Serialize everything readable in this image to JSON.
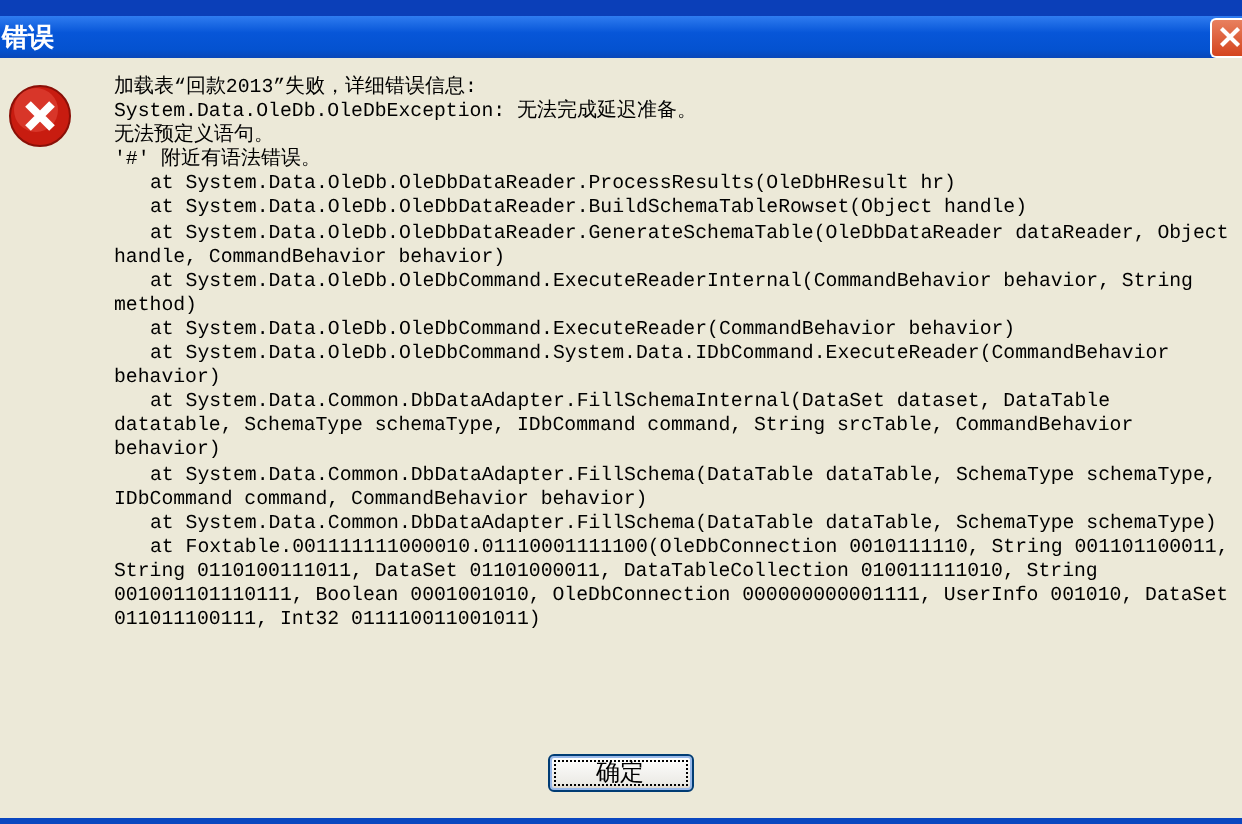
{
  "window": {
    "title": "错误"
  },
  "message": {
    "lines": [
      {
        "kind": "text",
        "text": "加载表“回款2013”失败，详细错误信息:"
      },
      {
        "kind": "text",
        "text": "System.Data.OleDb.OleDbException: 无法完成延迟准备。"
      },
      {
        "kind": "text",
        "text": "无法预定义语句。"
      },
      {
        "kind": "text",
        "text": "'#' 附近有语法错误。"
      },
      {
        "kind": "frame",
        "text": "at System.Data.OleDb.OleDbDataReader.ProcessResults(OleDbHResult hr)"
      },
      {
        "kind": "frame",
        "text": "at System.Data.OleDb.OleDbDataReader.BuildSchemaTableRowset(Object handle)"
      },
      {
        "kind": "frame",
        "text": "at System.Data.OleDb.OleDbDataReader.GenerateSchemaTable(OleDbDataReader dataReader, Object"
      },
      {
        "kind": "text",
        "text": "handle, CommandBehavior behavior)"
      },
      {
        "kind": "frame",
        "text": "at System.Data.OleDb.OleDbCommand.ExecuteReaderInternal(CommandBehavior behavior, String"
      },
      {
        "kind": "text",
        "text": "method)"
      },
      {
        "kind": "frame",
        "text": "at System.Data.OleDb.OleDbCommand.ExecuteReader(CommandBehavior behavior)"
      },
      {
        "kind": "frame",
        "text": "at System.Data.OleDb.OleDbCommand.System.Data.IDbCommand.ExecuteReader(CommandBehavior"
      },
      {
        "kind": "text",
        "text": "behavior)"
      },
      {
        "kind": "frame",
        "text": "at System.Data.Common.DbDataAdapter.FillSchemaInternal(DataSet dataset, DataTable"
      },
      {
        "kind": "text",
        "text": "datatable, SchemaType schemaType, IDbCommand command, String srcTable, CommandBehavior"
      },
      {
        "kind": "text",
        "text": "behavior)"
      },
      {
        "kind": "frame",
        "text": "at System.Data.Common.DbDataAdapter.FillSchema(DataTable dataTable, SchemaType schemaType,"
      },
      {
        "kind": "text",
        "text": "IDbCommand command, CommandBehavior behavior)"
      },
      {
        "kind": "frame",
        "text": "at System.Data.Common.DbDataAdapter.FillSchema(DataTable dataTable, SchemaType schemaType)"
      },
      {
        "kind": "frame",
        "text": "at Foxtable.001111111000010.01110001111100(OleDbConnection 0010111110, String 001101100011,"
      },
      {
        "kind": "text",
        "text": "String 0110100111011, DataSet 01101000011, DataTableCollection 010011111010, String"
      },
      {
        "kind": "text",
        "text": "001001101110111, Boolean 0001001010, OleDbConnection 000000000001111, UserInfo 001010, DataSet"
      },
      {
        "kind": "text",
        "text": "011011100111, Int32 011110011001011)"
      }
    ]
  },
  "buttons": [
    {
      "label": "确定"
    }
  ]
}
